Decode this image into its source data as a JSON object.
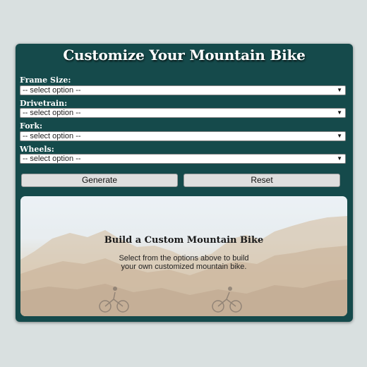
{
  "title": "Customize Your Mountain Bike",
  "fields": [
    {
      "label": "Frame Size:",
      "value": "-- select option --"
    },
    {
      "label": "Drivetrain:",
      "value": "-- select option --"
    },
    {
      "label": "Fork:",
      "value": "-- select option --"
    },
    {
      "label": "Wheels:",
      "value": "-- select option --"
    }
  ],
  "dropdown_arrow": "▼",
  "buttons": {
    "generate": "Generate",
    "reset": "Reset"
  },
  "hero": {
    "title": "Build a Custom Mountain Bike",
    "text": "Select from the options above to build your own customized mountain bike."
  },
  "colors": {
    "panel": "#154a4b",
    "background": "#d9e0e0",
    "button": "#dedede"
  }
}
